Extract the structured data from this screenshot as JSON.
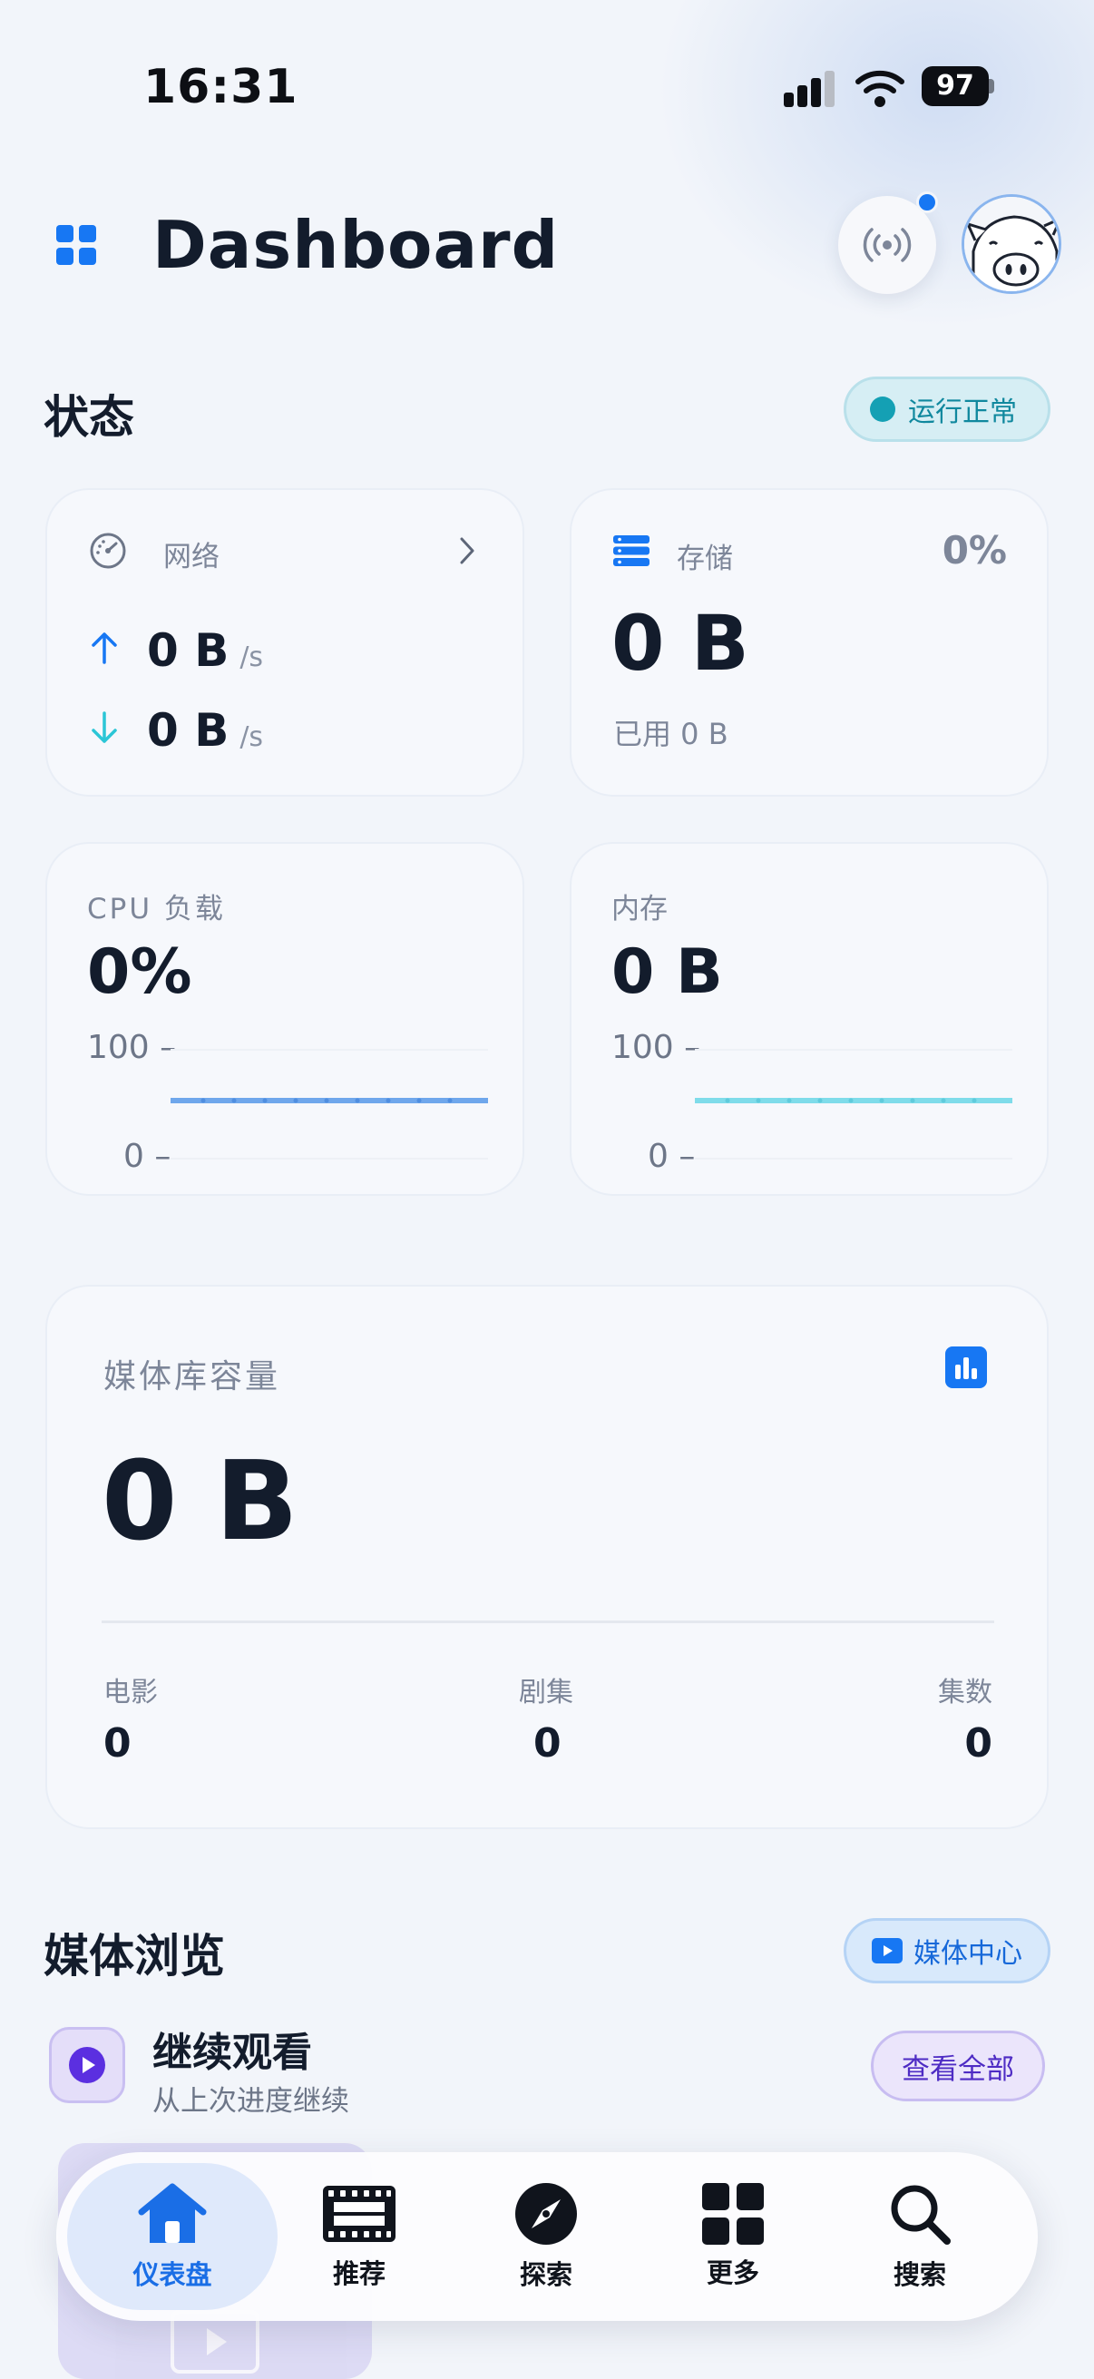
{
  "status_bar": {
    "time": "16:31",
    "battery": "97"
  },
  "header": {
    "title": "Dashboard"
  },
  "status_section": {
    "title": "状态",
    "badge": "运行正常"
  },
  "network": {
    "label": "网络",
    "upload_value": "0 B",
    "upload_unit": "/s",
    "download_value": "0 B",
    "download_unit": "/s"
  },
  "storage": {
    "label": "存储",
    "percent": "0%",
    "value": "0 B",
    "used": "已用 0 B"
  },
  "cpu": {
    "label": "CPU 负载",
    "value": "0%",
    "y_max": "100 –",
    "y_min": "0 –"
  },
  "memory": {
    "label": "内存",
    "value": "0 B",
    "y_max": "100 –",
    "y_min": "0 –"
  },
  "library": {
    "title": "媒体库容量",
    "value": "0 B",
    "stats": [
      {
        "label": "电影",
        "value": "0"
      },
      {
        "label": "剧集",
        "value": "0"
      },
      {
        "label": "集数",
        "value": "0"
      }
    ]
  },
  "media_browse": {
    "title": "媒体浏览",
    "media_center": "媒体中心",
    "continue_title": "继续观看",
    "continue_sub": "从上次进度继续",
    "view_all": "查看全部"
  },
  "tabs": [
    {
      "label": "仪表盘",
      "icon": "home-icon",
      "active": true
    },
    {
      "label": "推荐",
      "icon": "film-icon",
      "active": false
    },
    {
      "label": "探索",
      "icon": "compass-icon",
      "active": false
    },
    {
      "label": "更多",
      "icon": "grid-icon",
      "active": false
    },
    {
      "label": "搜索",
      "icon": "search-icon",
      "active": false
    }
  ],
  "colors": {
    "accent": "#1777f3",
    "cyan": "#14a0b4",
    "purple": "#5b2fe0",
    "text": "#131c2c"
  }
}
